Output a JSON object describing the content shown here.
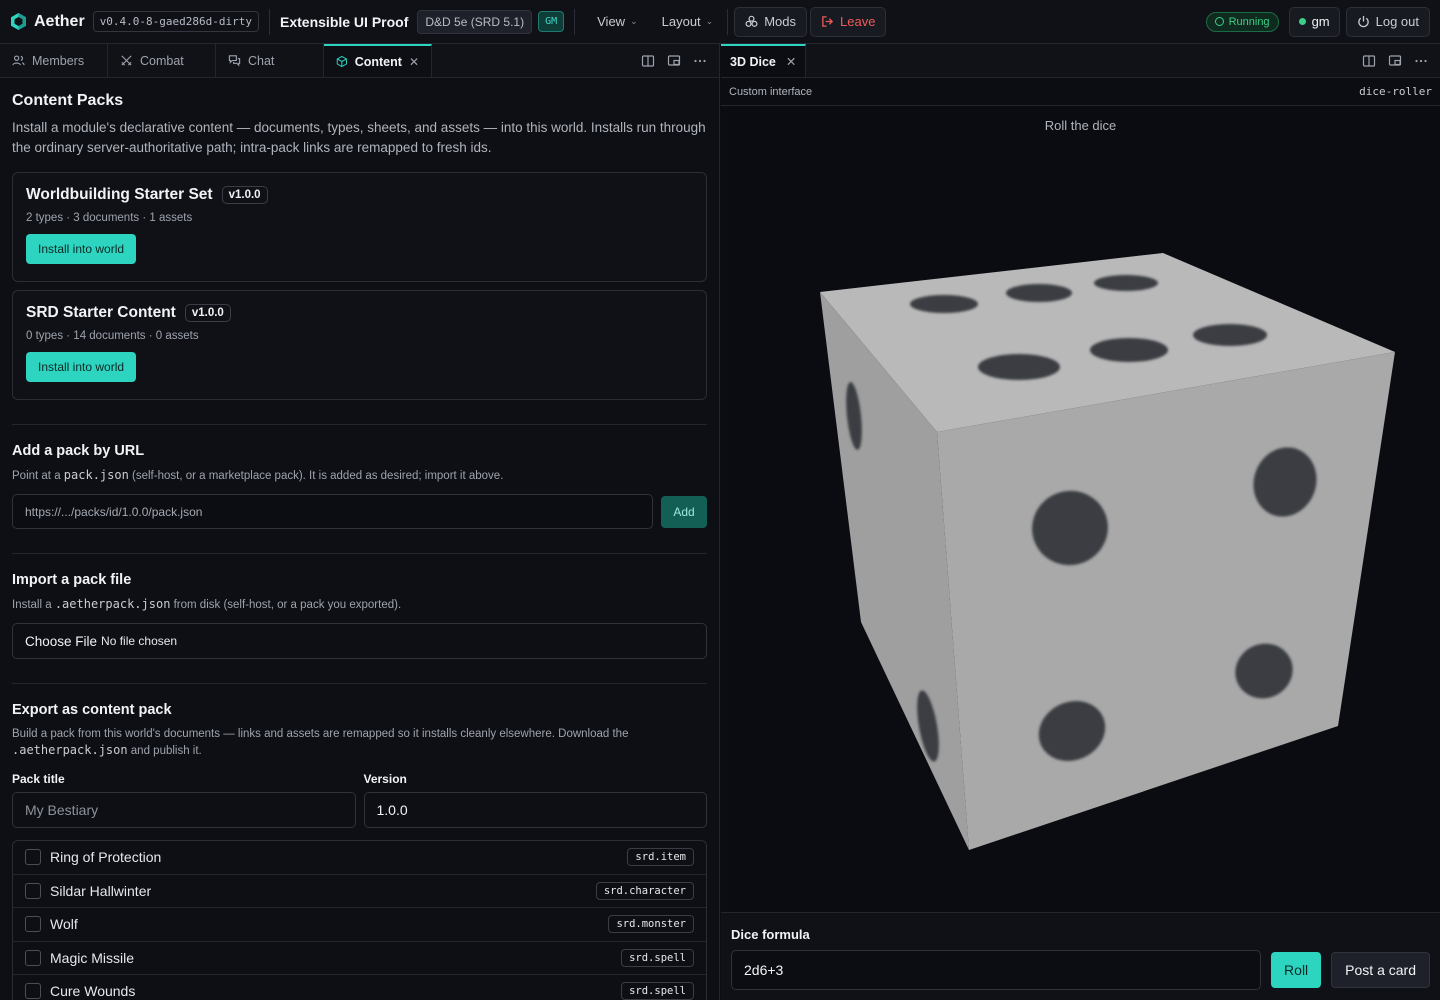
{
  "topbar": {
    "app_name": "Aether",
    "version": "v0.4.0-8-gaed286d-dirty",
    "proof_title": "Extensible UI Proof",
    "system": "D&D 5e (SRD 5.1)",
    "role_badge": "GM",
    "menus": [
      "View",
      "Layout"
    ],
    "mods_label": "Mods",
    "leave_label": "Leave",
    "status": "Running",
    "user": "gm",
    "logout_label": "Log out"
  },
  "left": {
    "tabs": [
      {
        "label": "Members",
        "icon": "users-icon"
      },
      {
        "label": "Combat",
        "icon": "swords-icon"
      },
      {
        "label": "Chat",
        "icon": "chat-icon"
      },
      {
        "label": "Content",
        "icon": "package-icon"
      }
    ],
    "title": "Content Packs",
    "lead": "Install a module's declarative content — documents, types, sheets, and assets — into this world. Installs run through the ordinary server-authoritative path; intra-pack links are remapped to fresh ids.",
    "packs": [
      {
        "title": "Worldbuilding Starter Set",
        "version": "v1.0.0",
        "meta": "2 types · 3 documents · 1 assets",
        "button": "Install into world"
      },
      {
        "title": "SRD Starter Content",
        "version": "v1.0.0",
        "meta": "0 types · 14 documents · 0 assets",
        "button": "Install into world"
      }
    ],
    "url_section": {
      "title": "Add a pack by URL",
      "desc_pre": "Point at a ",
      "desc_code": "pack.json",
      "desc_post": " (self-host, or a marketplace pack). It is added as desired; import it above.",
      "placeholder": "https://.../packs/id/1.0.0/pack.json",
      "button": "Add"
    },
    "import_section": {
      "title": "Import a pack file",
      "desc_pre": "Install a ",
      "desc_code": ".aetherpack.json",
      "desc_post": " from disk (self-host, or a pack you exported).",
      "choose": "Choose File",
      "no_file": "No file chosen"
    },
    "export_section": {
      "title": "Export as content pack",
      "desc_pre": "Build a pack from this world's documents — links and assets are remapped so it installs cleanly elsewhere. Download the ",
      "desc_code": ".aetherpack.json",
      "desc_post": " and publish it.",
      "pack_title_label": "Pack title",
      "pack_title_placeholder": "My Bestiary",
      "version_label": "Version",
      "version_value": "1.0.0",
      "documents": [
        {
          "name": "Ring of Protection",
          "type": "srd.item"
        },
        {
          "name": "Sildar Hallwinter",
          "type": "srd.character"
        },
        {
          "name": "Wolf",
          "type": "srd.monster"
        },
        {
          "name": "Magic Missile",
          "type": "srd.spell"
        },
        {
          "name": "Cure Wounds",
          "type": "srd.spell"
        }
      ]
    }
  },
  "right": {
    "tab": "3D Dice",
    "custom_label": "Custom interface",
    "custom_id": "dice-roller",
    "stage_title": "Roll the dice",
    "formula_label": "Dice formula",
    "formula_value": "2d6+3",
    "roll_label": "Roll",
    "post_label": "Post a card"
  }
}
